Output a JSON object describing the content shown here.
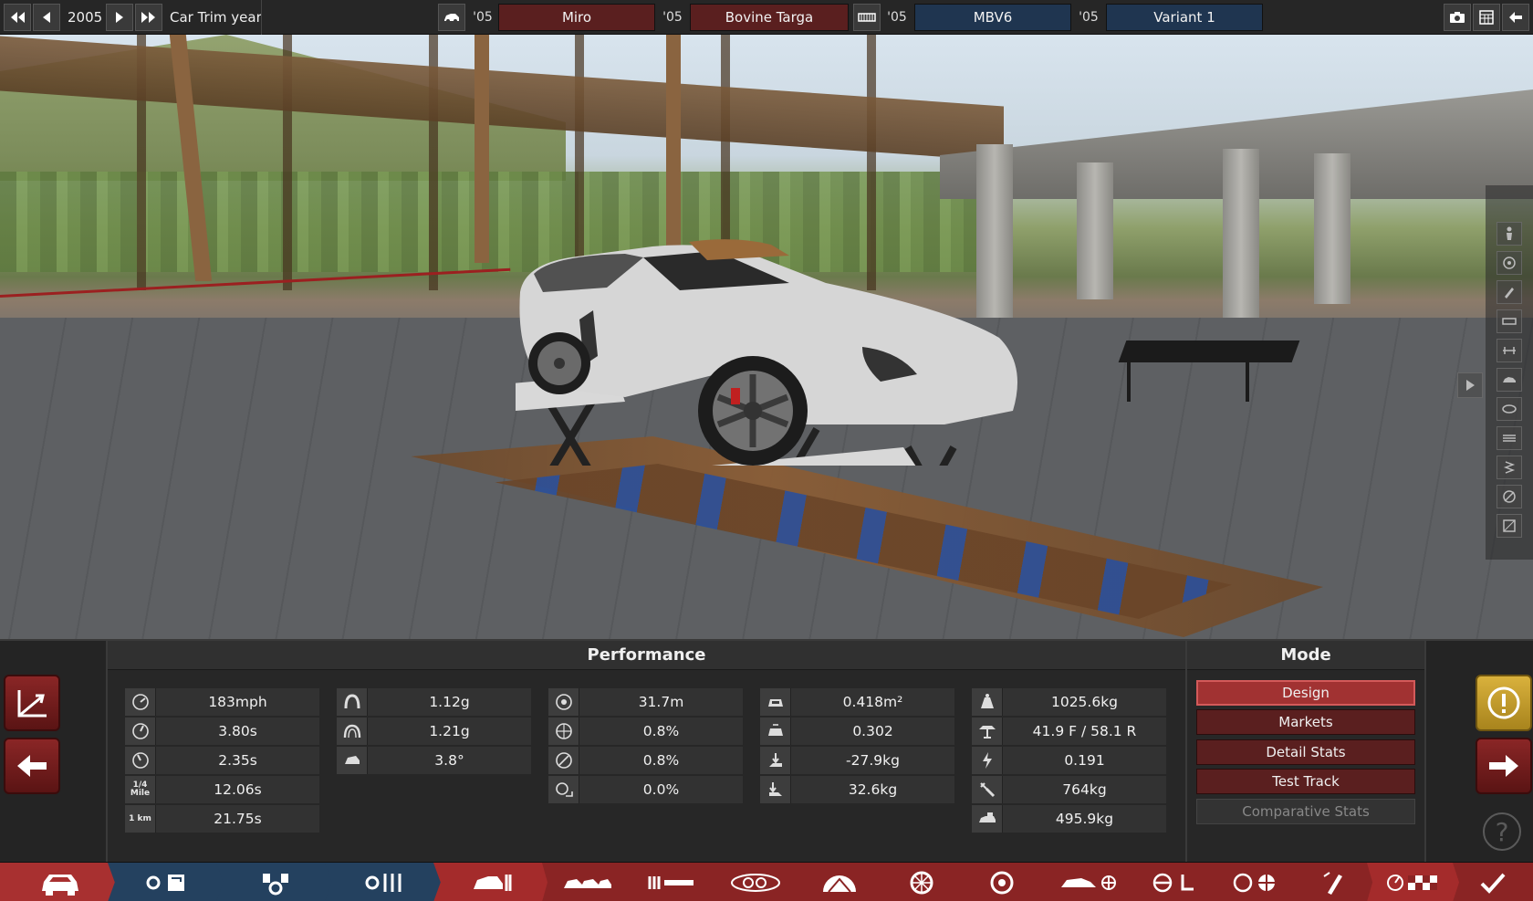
{
  "topbar": {
    "year": "2005",
    "year_label": "Car Trim year",
    "model_year_prefix": "'05",
    "model_name": "Miro",
    "trim_year_prefix": "'05",
    "trim_name": "Bovine Targa",
    "engine_year_prefix": "'05",
    "engine_name": "MBV6",
    "variant_year_prefix": "'05",
    "variant_name": "Variant 1"
  },
  "performance": {
    "header": "Performance",
    "col1": [
      {
        "icon": "top-speed-icon",
        "value": "183mph"
      },
      {
        "icon": "acceleration-0-100-icon",
        "value": "3.80s"
      },
      {
        "icon": "acceleration-0-60-icon",
        "value": "2.35s"
      },
      {
        "icon": "quarter-mile-icon",
        "value": "12.06s",
        "icon_text": "1/4 Mile"
      },
      {
        "icon": "kilometer-icon",
        "value": "21.75s",
        "icon_text": "1 km"
      }
    ],
    "col2": [
      {
        "icon": "cornering-icon",
        "value": "1.12g"
      },
      {
        "icon": "cornering-high-speed-icon",
        "value": "1.21g"
      },
      {
        "icon": "body-roll-icon",
        "value": "3.8°"
      }
    ],
    "col3": [
      {
        "icon": "braking-distance-icon",
        "value": "31.7m"
      },
      {
        "icon": "brake-fade-icon",
        "value": "0.8%"
      },
      {
        "icon": "brake-fade-long-icon",
        "value": "0.8%"
      },
      {
        "icon": "brake-lockup-icon",
        "value": "0.0%"
      }
    ],
    "col4": [
      {
        "icon": "frontal-area-icon",
        "value": "0.418m²"
      },
      {
        "icon": "drag-coefficient-icon",
        "value": "0.302"
      },
      {
        "icon": "front-downforce-icon",
        "value": "-27.9kg"
      },
      {
        "icon": "rear-downforce-icon",
        "value": "32.6kg"
      }
    ],
    "col5": [
      {
        "icon": "weight-icon",
        "value": "1025.6kg"
      },
      {
        "icon": "weight-distribution-icon",
        "value": "41.9 F / 58.1 R"
      },
      {
        "icon": "power-to-weight-icon",
        "value": "0.191"
      },
      {
        "icon": "towing-capacity-icon",
        "value": "764kg"
      },
      {
        "icon": "cargo-capacity-icon",
        "value": "495.9kg"
      }
    ]
  },
  "mode": {
    "header": "Mode",
    "buttons": [
      "Design",
      "Markets",
      "Detail Stats",
      "Test Track",
      "Comparative Stats"
    ]
  },
  "right": {
    "help_glyph": "?"
  },
  "colors": {
    "accent_red": "#8a2424",
    "accent_blue": "#24415f",
    "gold": "#d9b13c"
  }
}
